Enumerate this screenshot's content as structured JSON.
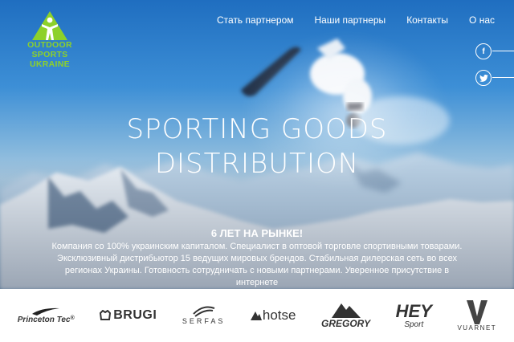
{
  "logo": {
    "line1": "OUTDOOR",
    "line2": "SPORTS",
    "line3": "UKRAINE",
    "color": "#8dd12a"
  },
  "nav": [
    {
      "label": "Стать партнером"
    },
    {
      "label": "Наши партнеры"
    },
    {
      "label": "Контакты"
    },
    {
      "label": "О нас"
    }
  ],
  "social": [
    {
      "glyph": "f",
      "icon": "facebook-icon"
    },
    {
      "glyph": "t",
      "icon": "twitter-icon"
    }
  ],
  "hero": {
    "headline_line1": "SPORTING GOODS",
    "headline_line2": "DISTRIBUTION",
    "years": "6 ЛЕТ НА РЫНКЕ!",
    "description": "Компания со 100% украинским капиталом. Специалист в оптовой торговле спортивными товарами. Эксклюзивный дистрибьютор 15 ведущих мировых брендов. Стабильная дилерская сеть во всех регионах Украины. Готовность сотрудничать с новыми партнерами. Уверенное присутствие в интернете"
  },
  "brands": [
    {
      "name": "Princeton Tec",
      "suffix": "®",
      "icon": "princeton-tec-logo"
    },
    {
      "name": "BRUGI",
      "icon": "brugi-logo"
    },
    {
      "name": "SERFAS",
      "icon": "serfas-logo"
    },
    {
      "name": "hotse",
      "icon": "hotse-logo"
    },
    {
      "name": "GREGORY",
      "icon": "gregory-logo"
    },
    {
      "name": "HEY",
      "sub": "Sport",
      "icon": "hey-sport-logo"
    },
    {
      "name": "VUARNET",
      "icon": "vuarnet-logo"
    }
  ]
}
